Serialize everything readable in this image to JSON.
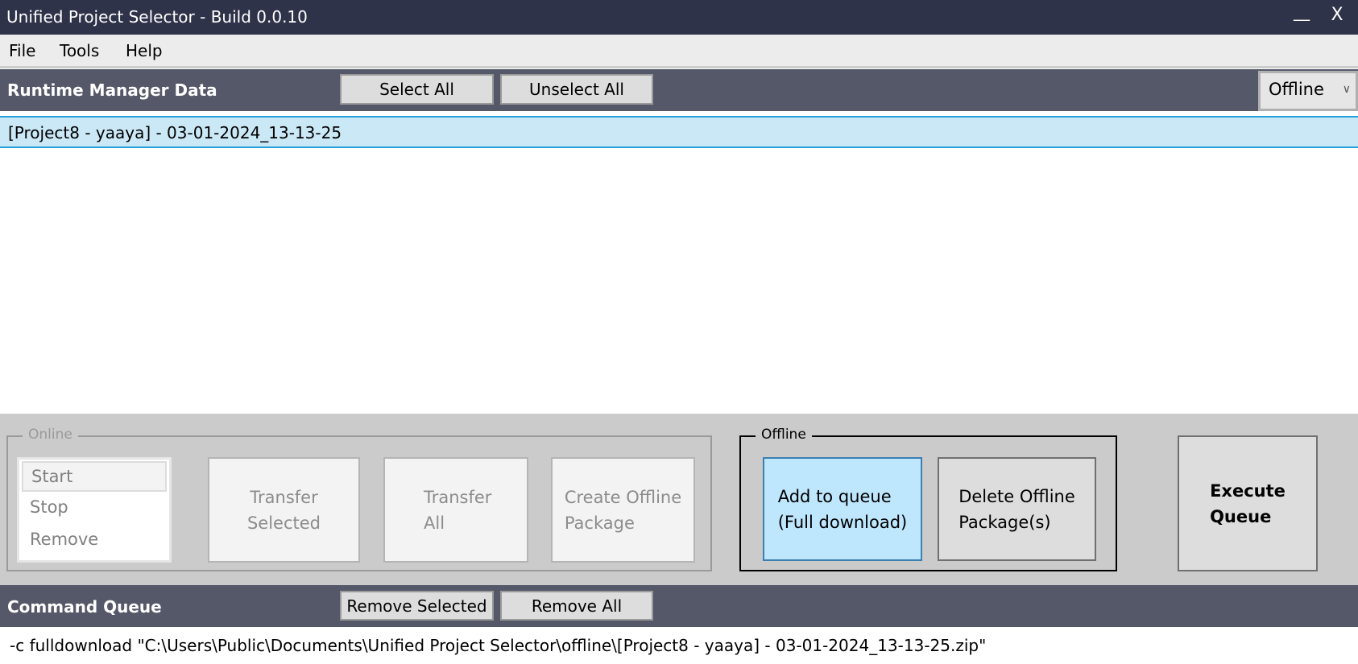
{
  "window": {
    "title": "Unified Project Selector - Build 0.0.10",
    "minimize": "__",
    "close": "X"
  },
  "menu": [
    "File",
    "Tools",
    "Help"
  ],
  "runtime": {
    "title": "Runtime Manager Data",
    "select_all": "Select All",
    "unselect_all": "Unselect All",
    "mode": "Offline",
    "items": [
      "[Project8 - yaaya] - 03-01-2024_13-13-25"
    ]
  },
  "online": {
    "legend": "Online",
    "actions": [
      "Start",
      "Stop",
      "Remove"
    ],
    "transfer_selected": [
      "Transfer",
      "Selected"
    ],
    "transfer_all": [
      "Transfer",
      "All"
    ],
    "create_offline": [
      "Create Offline",
      "Package"
    ]
  },
  "offline": {
    "legend": "Offline",
    "add_to_queue": [
      "Add to queue",
      "(Full download)"
    ],
    "delete_offline": [
      "Delete Offline",
      "Package(s)"
    ]
  },
  "execute": [
    "Execute",
    "Queue"
  ],
  "queue": {
    "title": "Command Queue",
    "remove_selected": "Remove Selected",
    "remove_all": "Remove All",
    "items": [
      "-c fulldownload \"C:\\Users\\Public\\Documents\\Unified Project Selector\\offline\\[Project8 - yaaya] - 03-01-2024_13-13-25.zip\""
    ]
  },
  "colors": {
    "titlebar": "#2f334a",
    "header": "#555869",
    "selection": "#cbe8f6",
    "accent": "#26a0da",
    "add_button": "#bee6fd"
  }
}
